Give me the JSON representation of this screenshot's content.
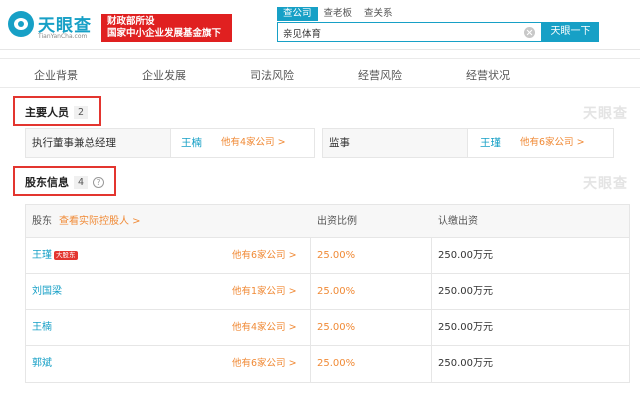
{
  "header": {
    "logo_cn": "天眼查",
    "logo_en": "TianYanCha.com",
    "badge_line1": "财政部所设",
    "badge_line2": "国家中小企业发展基金旗下",
    "search_tabs": [
      "查公司",
      "查老板",
      "查关系"
    ],
    "search_value": "亲见体育",
    "search_button": "天眼一下"
  },
  "nav": {
    "items": [
      "企业背景",
      "企业发展",
      "司法风险",
      "经营风险",
      "经营状况"
    ]
  },
  "watermark": "天眼查",
  "key_personnel": {
    "title": "主要人员",
    "count": "2",
    "people": [
      {
        "role": "执行董事兼总经理",
        "name": "王楠",
        "more": "他有4家公司 >"
      },
      {
        "role": "监事",
        "name": "王瑾",
        "more": "他有6家公司 >"
      }
    ]
  },
  "shareholders": {
    "title": "股东信息",
    "count": "4",
    "help": "?",
    "col_holder": "股东",
    "col_holder_link": "查看实际控股人 >",
    "col_ratio": "出资比例",
    "col_amount": "认缴出资",
    "rows": [
      {
        "name": "王瑾",
        "tag": "大股东",
        "more": "他有6家公司 >",
        "ratio": "25.00%",
        "amount": "250.00万元"
      },
      {
        "name": "刘国梁",
        "tag": "",
        "more": "他有1家公司 >",
        "ratio": "25.00%",
        "amount": "250.00万元"
      },
      {
        "name": "王楠",
        "tag": "",
        "more": "他有4家公司 >",
        "ratio": "25.00%",
        "amount": "250.00万元"
      },
      {
        "name": "郭斌",
        "tag": "",
        "more": "他有6家公司 >",
        "ratio": "25.00%",
        "amount": "250.00万元"
      }
    ]
  },
  "colors": {
    "brand": "#17a0c6",
    "highlight_box": "#e3352f",
    "link_orange": "#f08a36"
  }
}
